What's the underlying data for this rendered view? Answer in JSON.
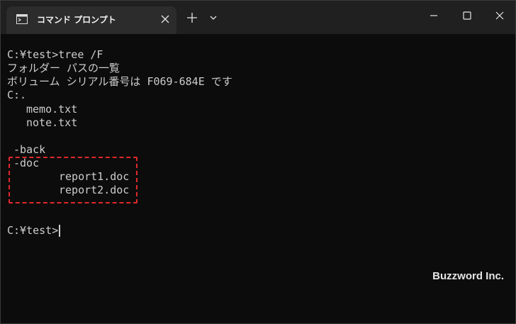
{
  "window": {
    "tab_title": "コマンド プロンプト",
    "icons": {
      "tab": "terminal-icon",
      "close_tab": "close-icon",
      "new_tab": "plus-icon",
      "dropdown": "chevron-down-icon",
      "minimize": "minimize-icon",
      "maximize": "maximize-icon",
      "close_window": "close-icon"
    }
  },
  "terminal": {
    "lines": [
      "C:¥test>tree /F",
      "フォルダー パスの一覧",
      "ボリューム シリアル番号は F069-684E です",
      "C:.",
      "memo.txt",
      "note.txt",
      "-back",
      "-doc",
      "report1.doc",
      "report2.doc",
      "C:¥test>"
    ],
    "highlight_color": "#e0282c",
    "text_color": "#cccccc",
    "background": "#0c0c0c"
  },
  "watermark": "Buzzword Inc."
}
